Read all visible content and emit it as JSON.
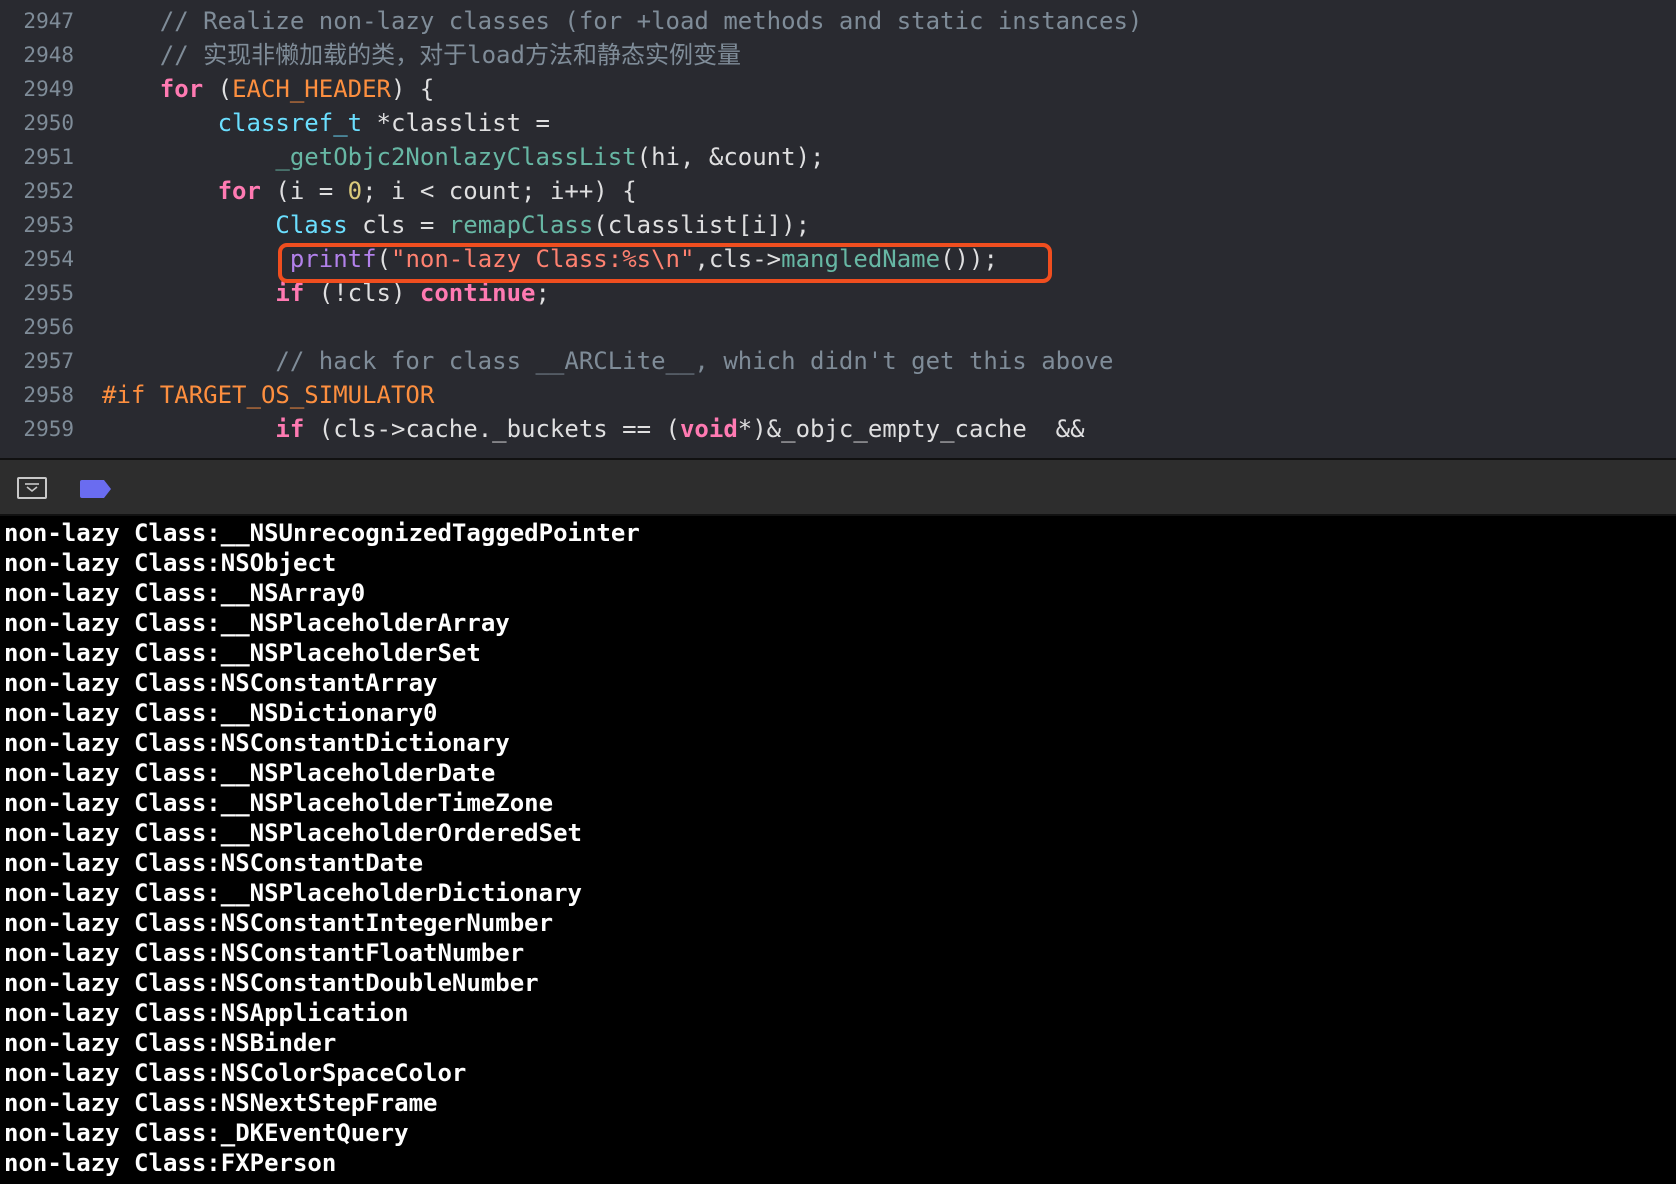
{
  "editor": {
    "lines": [
      {
        "num": "2947",
        "tokens": [
          {
            "t": "    // Realize non-lazy classes (for +load methods and static instances)",
            "c": "comment"
          }
        ]
      },
      {
        "num": "2948",
        "tokens": [
          {
            "t": "    // 实现非懒加载的类，对于load方法和静态实例变量",
            "c": "comment"
          }
        ]
      },
      {
        "num": "2949",
        "tokens": [
          {
            "t": "    ",
            "c": "plain"
          },
          {
            "t": "for",
            "c": "keyword"
          },
          {
            "t": " (",
            "c": "plain"
          },
          {
            "t": "EACH_HEADER",
            "c": "macro"
          },
          {
            "t": ") {",
            "c": "plain"
          }
        ]
      },
      {
        "num": "2950",
        "tokens": [
          {
            "t": "        ",
            "c": "plain"
          },
          {
            "t": "classref_t",
            "c": "type"
          },
          {
            "t": " *classlist =",
            "c": "plain"
          }
        ]
      },
      {
        "num": "2951",
        "tokens": [
          {
            "t": "            ",
            "c": "plain"
          },
          {
            "t": "_getObjc2NonlazyClassList",
            "c": "func"
          },
          {
            "t": "(hi, &count);",
            "c": "plain"
          }
        ]
      },
      {
        "num": "2952",
        "tokens": [
          {
            "t": "        ",
            "c": "plain"
          },
          {
            "t": "for",
            "c": "keyword"
          },
          {
            "t": " (i = ",
            "c": "plain"
          },
          {
            "t": "0",
            "c": "number"
          },
          {
            "t": "; i < count; i++) {",
            "c": "plain"
          }
        ]
      },
      {
        "num": "2953",
        "tokens": [
          {
            "t": "            ",
            "c": "plain"
          },
          {
            "t": "Class",
            "c": "type"
          },
          {
            "t": " cls = ",
            "c": "plain"
          },
          {
            "t": "remapClass",
            "c": "func"
          },
          {
            "t": "(classlist[i]);",
            "c": "plain"
          }
        ]
      },
      {
        "num": "2954",
        "tokens": [
          {
            "t": "             ",
            "c": "plain"
          },
          {
            "t": "printf",
            "c": "objcfunc"
          },
          {
            "t": "(",
            "c": "plain"
          },
          {
            "t": "\"non-lazy Class:%s\\n\"",
            "c": "string"
          },
          {
            "t": ",cls->",
            "c": "plain"
          },
          {
            "t": "mangledName",
            "c": "func"
          },
          {
            "t": "());",
            "c": "plain"
          }
        ]
      },
      {
        "num": "2955",
        "tokens": [
          {
            "t": "            ",
            "c": "plain"
          },
          {
            "t": "if",
            "c": "keyword"
          },
          {
            "t": " (!cls) ",
            "c": "plain"
          },
          {
            "t": "continue",
            "c": "keyword"
          },
          {
            "t": ";",
            "c": "plain"
          }
        ]
      },
      {
        "num": "2956",
        "tokens": []
      },
      {
        "num": "2957",
        "tokens": [
          {
            "t": "            // hack for class __ARCLite__, which didn't get this above",
            "c": "comment"
          }
        ]
      },
      {
        "num": "2958",
        "tokens": [
          {
            "t": "#if ",
            "c": "macro"
          },
          {
            "t": "TARGET_OS_SIMULATOR",
            "c": "macro"
          }
        ]
      },
      {
        "num": "2959",
        "tokens": [
          {
            "t": "            ",
            "c": "plain"
          },
          {
            "t": "if",
            "c": "keyword"
          },
          {
            "t": " (cls->cache._buckets == (",
            "c": "plain"
          },
          {
            "t": "void",
            "c": "keyword"
          },
          {
            "t": "*)&_objc_empty_cache  &&",
            "c": "plain"
          }
        ]
      }
    ]
  },
  "colors": {
    "highlight_border": "#f04e1f",
    "breakpoint_tag": "#6a6cf0",
    "editor_bg": "#292a30",
    "console_bg": "#000000"
  },
  "debug_bar": {
    "toggle_icon": "chevron-down-box-icon",
    "tag_icon": "breakpoint-tag-icon"
  },
  "console": {
    "lines": [
      "non-lazy Class:__NSUnrecognizedTaggedPointer",
      "non-lazy Class:NSObject",
      "non-lazy Class:__NSArray0",
      "non-lazy Class:__NSPlaceholderArray",
      "non-lazy Class:__NSPlaceholderSet",
      "non-lazy Class:NSConstantArray",
      "non-lazy Class:__NSDictionary0",
      "non-lazy Class:NSConstantDictionary",
      "non-lazy Class:__NSPlaceholderDate",
      "non-lazy Class:__NSPlaceholderTimeZone",
      "non-lazy Class:__NSPlaceholderOrderedSet",
      "non-lazy Class:NSConstantDate",
      "non-lazy Class:__NSPlaceholderDictionary",
      "non-lazy Class:NSConstantIntegerNumber",
      "non-lazy Class:NSConstantFloatNumber",
      "non-lazy Class:NSConstantDoubleNumber",
      "non-lazy Class:NSApplication",
      "non-lazy Class:NSBinder",
      "non-lazy Class:NSColorSpaceColor",
      "non-lazy Class:NSNextStepFrame",
      "non-lazy Class:_DKEventQuery",
      "non-lazy Class:FXPerson"
    ]
  }
}
